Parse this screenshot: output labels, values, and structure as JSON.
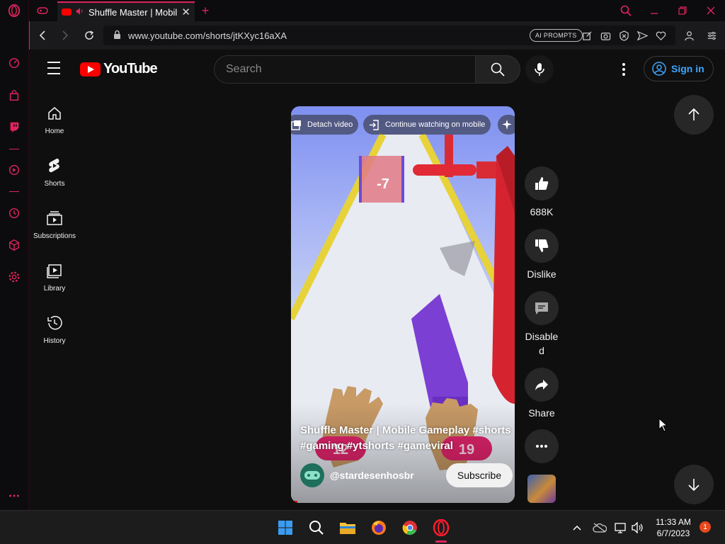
{
  "browser": {
    "tab": {
      "title": "Shuffle Master | Mobile"
    },
    "url": "www.youtube.com/shorts/jtKXyc16aXA",
    "ai_prompts_label": "AI PROMPTS"
  },
  "youtube": {
    "logo_text": "YouTube",
    "search_placeholder": "Search",
    "sign_in_label": "Sign in",
    "guide": [
      {
        "label": "Home",
        "icon": "home-icon"
      },
      {
        "label": "Shorts",
        "icon": "shorts-icon"
      },
      {
        "label": "Subscriptions",
        "icon": "subscriptions-icon"
      },
      {
        "label": "Library",
        "icon": "library-icon"
      },
      {
        "label": "History",
        "icon": "history-icon"
      }
    ]
  },
  "short": {
    "detach_label": "Detach video",
    "continue_label": "Continue watching on mobile",
    "caption": "Shuffle Master | Mobile Gameplay #shorts #gaming #ytshorts #gameviral",
    "channel": "@stardesenhosbr",
    "subscribe_label": "Subscribe",
    "in_game": {
      "gate_value": "-7",
      "left_counter": "12",
      "right_counter": "19"
    },
    "progress_fraction": 0.03,
    "actions": {
      "like_count": "688K",
      "dislike_label": "Dislike",
      "comments_label_line1": "Disable",
      "comments_label_line2": "d",
      "share_label": "Share"
    }
  },
  "taskbar": {
    "time": "11:33 AM",
    "date": "6/7/2023",
    "notification_count": "1"
  },
  "colors": {
    "opera_accent": "#e0245e",
    "youtube_red": "#ff0000",
    "sign_in_blue": "#3ea6ff"
  }
}
